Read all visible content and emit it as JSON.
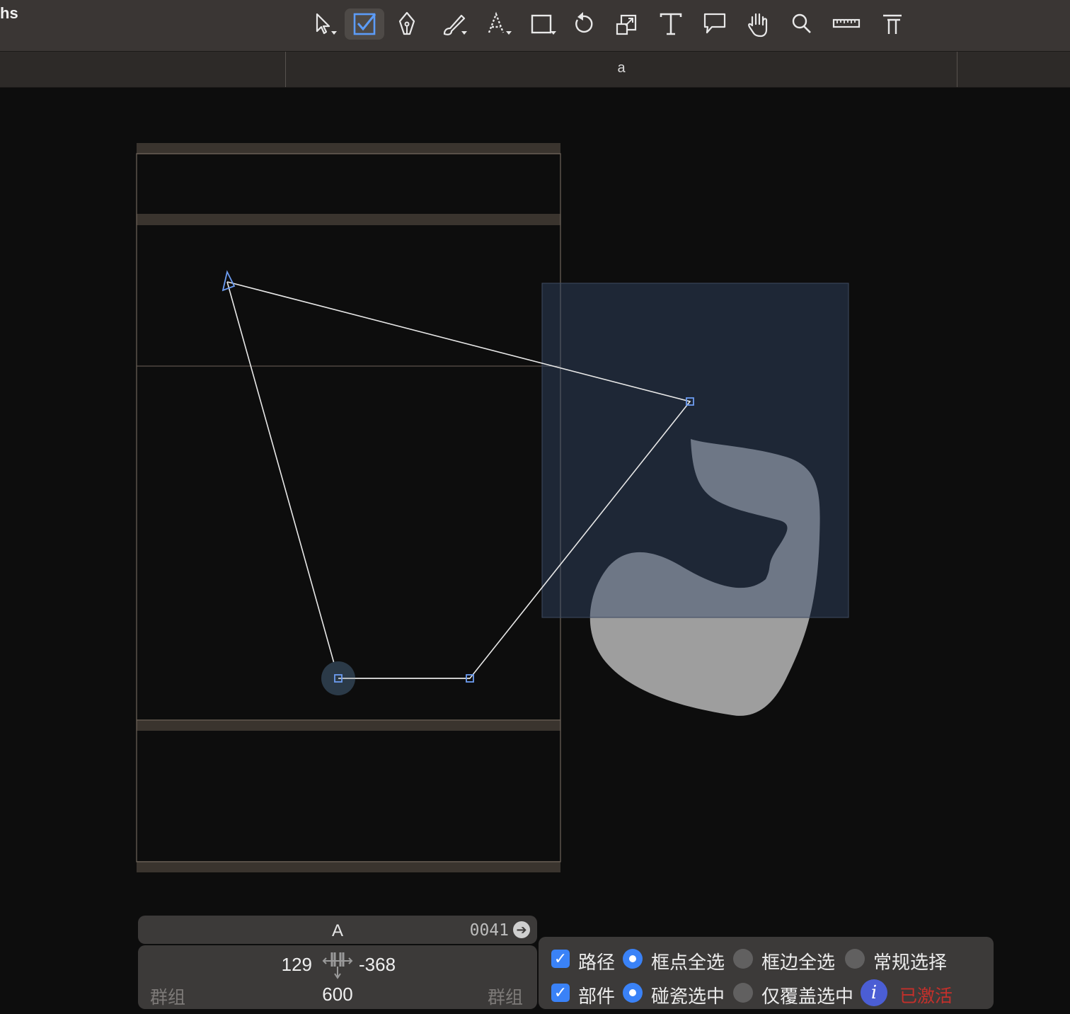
{
  "app": {
    "title": "hs"
  },
  "toolbar": {
    "tools": [
      {
        "name": "select-tool",
        "icon": "arrow-cursor-icon",
        "active": false
      },
      {
        "name": "select-all-tool",
        "icon": "checkbox-icon",
        "active": true
      },
      {
        "name": "pen-tool",
        "icon": "pen-nib-icon",
        "active": false
      },
      {
        "name": "brush-tool",
        "icon": "brush-icon",
        "active": false
      },
      {
        "name": "dotted-text-tool",
        "icon": "dotted-a-icon",
        "active": false
      },
      {
        "name": "rectangle-tool",
        "icon": "rectangle-icon",
        "active": false
      },
      {
        "name": "rotate-tool",
        "icon": "rotate-icon",
        "active": false
      },
      {
        "name": "scale-tool",
        "icon": "scale-icon",
        "active": false
      },
      {
        "name": "text-tool",
        "icon": "text-icon",
        "active": false
      },
      {
        "name": "annotation-tool",
        "icon": "speech-bubble-icon",
        "active": false
      },
      {
        "name": "hand-tool",
        "icon": "hand-icon",
        "active": false
      },
      {
        "name": "zoom-tool",
        "icon": "magnifier-icon",
        "active": false
      },
      {
        "name": "measure-tool",
        "icon": "ruler-icon",
        "active": false
      },
      {
        "name": "type-tool",
        "icon": "type-icon",
        "active": false
      }
    ],
    "accent_color": "#3a82f7"
  },
  "tab": {
    "title": "a"
  },
  "glyph": {
    "name": "A",
    "unicode": "0041"
  },
  "metrics": {
    "lsb": "129",
    "rsb": "-368",
    "advance_width": "600",
    "left_group": "群组",
    "right_group": "群组"
  },
  "options": {
    "path_label": "路径",
    "path_checked": true,
    "component_label": "部件",
    "component_checked": true,
    "row1": [
      {
        "label": "框点全选",
        "selected": true
      },
      {
        "label": "框边全选",
        "selected": false
      },
      {
        "label": "常规选择",
        "selected": false
      }
    ],
    "row2": [
      {
        "label": "碰瓷选中",
        "selected": true
      },
      {
        "label": "仅覆盖选中",
        "selected": false
      }
    ],
    "status": "已激活",
    "status_color": "#c4302b"
  }
}
